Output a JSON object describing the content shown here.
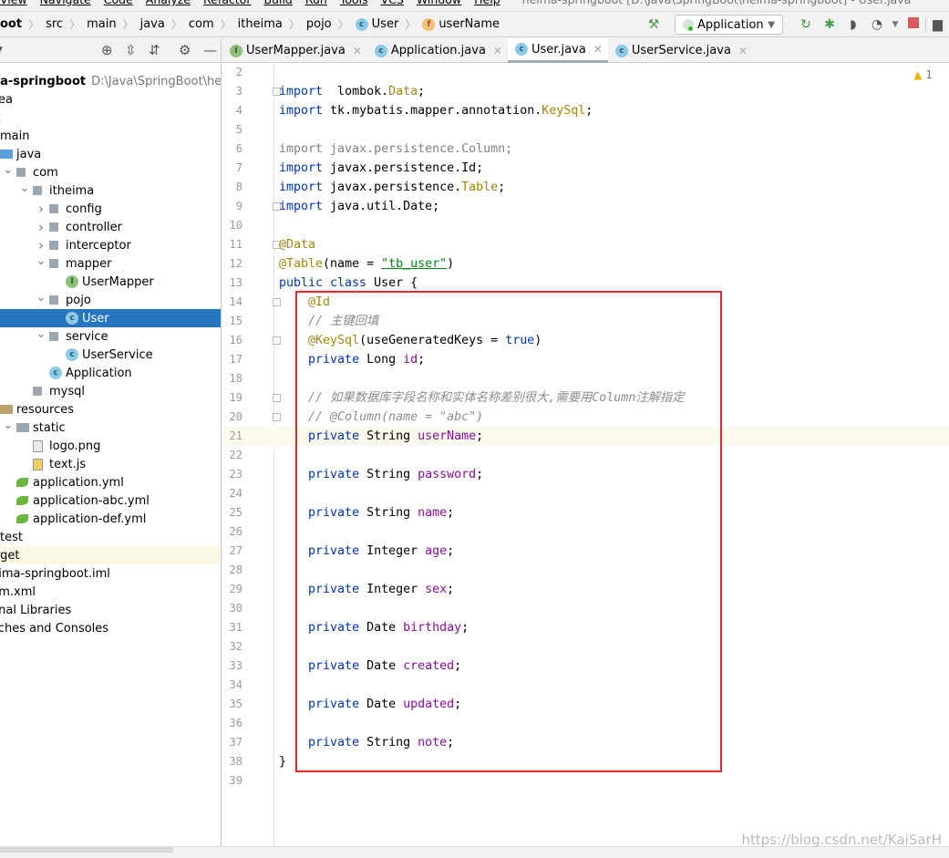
{
  "menu": {
    "items": [
      "View",
      "Navigate",
      "Code",
      "Analyze",
      "Refactor",
      "Build",
      "Run",
      "Tools",
      "VCS",
      "Window",
      "Help"
    ],
    "title": "heima-springboot [D:\\Java\\SpringBoot\\heima-springboot] - User.java"
  },
  "breadcrumb": [
    "oot",
    "src",
    "main",
    "java",
    "com",
    "itheima",
    "pojo",
    "User",
    "userName"
  ],
  "run_config": "Application",
  "project_tree": [
    {
      "label": "heima-springboot",
      "extra": "D:\\Java\\SpringBoot\\heima-springboot",
      "depth": 0,
      "icon": "module-folder",
      "bold": true
    },
    {
      "label": ".idea",
      "depth": 1,
      "icon": "folder"
    },
    {
      "label": "src",
      "depth": 1,
      "icon": "folder"
    },
    {
      "label": "main",
      "depth": 2,
      "icon": "folder",
      "expanded": true
    },
    {
      "label": "java",
      "depth": 3,
      "icon": "source-folder",
      "expanded": true
    },
    {
      "label": "com",
      "depth": 4,
      "icon": "package",
      "expanded": true,
      "arrow": true
    },
    {
      "label": "itheima",
      "depth": 5,
      "icon": "package",
      "expanded": true,
      "arrow": true
    },
    {
      "label": "config",
      "depth": 6,
      "icon": "package",
      "arrow": true
    },
    {
      "label": "controller",
      "depth": 6,
      "icon": "package",
      "arrow": true
    },
    {
      "label": "interceptor",
      "depth": 6,
      "icon": "package",
      "arrow": true
    },
    {
      "label": "mapper",
      "depth": 6,
      "icon": "package",
      "expanded": true,
      "arrow": true
    },
    {
      "label": "UserMapper",
      "depth": 7,
      "icon": "interface"
    },
    {
      "label": "pojo",
      "depth": 6,
      "icon": "package",
      "expanded": true,
      "arrow": true
    },
    {
      "label": "User",
      "depth": 7,
      "icon": "class",
      "selected": true
    },
    {
      "label": "service",
      "depth": 6,
      "icon": "package",
      "expanded": true,
      "arrow": true
    },
    {
      "label": "UserService",
      "depth": 7,
      "icon": "class"
    },
    {
      "label": "Application",
      "depth": 6,
      "icon": "spring-boot-class"
    },
    {
      "label": "mysql",
      "depth": 5,
      "icon": "package"
    },
    {
      "label": "resources",
      "depth": 3,
      "icon": "resources-folder",
      "arrow": true,
      "expanded": true
    },
    {
      "label": "static",
      "depth": 4,
      "icon": "folder",
      "expanded": true,
      "arrow": true
    },
    {
      "label": "logo.png",
      "depth": 5,
      "icon": "image-file"
    },
    {
      "label": "text.js",
      "depth": 5,
      "icon": "js-file"
    },
    {
      "label": "application.yml",
      "depth": 4,
      "icon": "yml-file"
    },
    {
      "label": "application-abc.yml",
      "depth": 4,
      "icon": "yml-file"
    },
    {
      "label": "application-def.yml",
      "depth": 4,
      "icon": "yml-file"
    },
    {
      "label": "test",
      "depth": 2,
      "icon": "folder"
    },
    {
      "label": "target",
      "depth": 1,
      "icon": "folder",
      "highlighted": true
    },
    {
      "label": "heima-springboot.iml",
      "depth": 1,
      "icon": "iml-file"
    },
    {
      "label": "pom.xml",
      "depth": 1,
      "icon": "xml-file"
    },
    {
      "label": "External Libraries",
      "depth": 0,
      "icon": "library"
    },
    {
      "label": "Scratches and Consoles",
      "depth": 0,
      "icon": "scratch"
    }
  ],
  "tabs": [
    {
      "label": "UserMapper.java",
      "icon": "I",
      "kind": "interface"
    },
    {
      "label": "Application.java",
      "icon": "C",
      "kind": "spring"
    },
    {
      "label": "User.java",
      "icon": "C",
      "kind": "class",
      "active": true
    },
    {
      "label": "UserService.java",
      "icon": "C",
      "kind": "class"
    }
  ],
  "editor": {
    "warnings": "1",
    "current_line": 21,
    "first_line": 2,
    "lines": [
      {
        "n": 2,
        "t": []
      },
      {
        "n": 3,
        "fold": true,
        "t": [
          [
            "kw",
            "import"
          ],
          [
            "",
            "  lombok."
          ],
          [
            "an",
            "Data"
          ],
          [
            "",
            ";"
          ]
        ]
      },
      {
        "n": 4,
        "t": [
          [
            "kw",
            "import"
          ],
          [
            "",
            " tk.mybatis.mapper.annotation."
          ],
          [
            "an",
            "KeySql"
          ],
          [
            "",
            ";"
          ]
        ]
      },
      {
        "n": 5,
        "t": []
      },
      {
        "n": 6,
        "t": [
          [
            "un",
            "import javax.persistence.Column;"
          ]
        ]
      },
      {
        "n": 7,
        "t": [
          [
            "kw",
            "import"
          ],
          [
            "",
            " javax.persistence.Id;"
          ]
        ]
      },
      {
        "n": 8,
        "t": [
          [
            "kw",
            "import"
          ],
          [
            "",
            " javax.persistence."
          ],
          [
            "an",
            "Table"
          ],
          [
            "",
            ";"
          ]
        ]
      },
      {
        "n": 9,
        "fold": true,
        "t": [
          [
            "kw",
            "import"
          ],
          [
            "",
            " java.util.Date;"
          ]
        ]
      },
      {
        "n": 10,
        "t": []
      },
      {
        "n": 11,
        "fold": true,
        "t": [
          [
            "an",
            "@Data"
          ]
        ]
      },
      {
        "n": 12,
        "t": [
          [
            "an",
            "@Table"
          ],
          [
            "",
            "(name = "
          ],
          [
            "st",
            "\"tb_user\""
          ],
          [
            "",
            ")"
          ]
        ]
      },
      {
        "n": 13,
        "t": [
          [
            "kw",
            "public class"
          ],
          [
            "",
            " User {"
          ]
        ]
      },
      {
        "n": 14,
        "fold": true,
        "t": [
          [
            "",
            "    "
          ],
          [
            "an",
            "@Id"
          ]
        ]
      },
      {
        "n": 15,
        "t": [
          [
            "",
            "    "
          ],
          [
            "cm",
            "// 主键回填"
          ]
        ]
      },
      {
        "n": 16,
        "fold": true,
        "t": [
          [
            "",
            "    "
          ],
          [
            "an",
            "@KeySql"
          ],
          [
            "",
            "(useGeneratedKeys = "
          ],
          [
            "kw",
            "true"
          ],
          [
            "",
            ")"
          ]
        ]
      },
      {
        "n": 17,
        "t": [
          [
            "",
            "    "
          ],
          [
            "kw",
            "private"
          ],
          [
            "",
            " Long "
          ],
          [
            "fd",
            "id"
          ],
          [
            "",
            ";"
          ]
        ]
      },
      {
        "n": 18,
        "t": []
      },
      {
        "n": 19,
        "fold": true,
        "t": [
          [
            "",
            "    "
          ],
          [
            "cm",
            "// 如果数据库字段名称和实体名称差别很大,需要用Column注解指定"
          ]
        ]
      },
      {
        "n": 20,
        "fold": true,
        "t": [
          [
            "",
            "    "
          ],
          [
            "cm",
            "// @Column(name = \"abc\")"
          ]
        ]
      },
      {
        "n": 21,
        "t": [
          [
            "",
            "    "
          ],
          [
            "kw",
            "private"
          ],
          [
            "",
            " String "
          ],
          [
            "fd",
            "userName"
          ],
          [
            "",
            ";"
          ]
        ]
      },
      {
        "n": 22,
        "t": []
      },
      {
        "n": 23,
        "t": [
          [
            "",
            "    "
          ],
          [
            "kw",
            "private"
          ],
          [
            "",
            " String "
          ],
          [
            "fd",
            "password"
          ],
          [
            "",
            ";"
          ]
        ]
      },
      {
        "n": 24,
        "t": []
      },
      {
        "n": 25,
        "t": [
          [
            "",
            "    "
          ],
          [
            "kw",
            "private"
          ],
          [
            "",
            " String "
          ],
          [
            "fd",
            "name"
          ],
          [
            "",
            ";"
          ]
        ]
      },
      {
        "n": 26,
        "t": []
      },
      {
        "n": 27,
        "t": [
          [
            "",
            "    "
          ],
          [
            "kw",
            "private"
          ],
          [
            "",
            " Integer "
          ],
          [
            "fd",
            "age"
          ],
          [
            "",
            ";"
          ]
        ]
      },
      {
        "n": 28,
        "t": []
      },
      {
        "n": 29,
        "t": [
          [
            "",
            "    "
          ],
          [
            "kw",
            "private"
          ],
          [
            "",
            " Integer "
          ],
          [
            "fd",
            "sex"
          ],
          [
            "",
            ";"
          ]
        ]
      },
      {
        "n": 30,
        "t": []
      },
      {
        "n": 31,
        "t": [
          [
            "",
            "    "
          ],
          [
            "kw",
            "private"
          ],
          [
            "",
            " Date "
          ],
          [
            "fd",
            "birthday"
          ],
          [
            "",
            ";"
          ]
        ]
      },
      {
        "n": 32,
        "t": []
      },
      {
        "n": 33,
        "t": [
          [
            "",
            "    "
          ],
          [
            "kw",
            "private"
          ],
          [
            "",
            " Date "
          ],
          [
            "fd",
            "created"
          ],
          [
            "",
            ";"
          ]
        ]
      },
      {
        "n": 34,
        "t": []
      },
      {
        "n": 35,
        "t": [
          [
            "",
            "    "
          ],
          [
            "kw",
            "private"
          ],
          [
            "",
            " Date "
          ],
          [
            "fd",
            "updated"
          ],
          [
            "",
            ";"
          ]
        ]
      },
      {
        "n": 36,
        "t": []
      },
      {
        "n": 37,
        "t": [
          [
            "",
            "    "
          ],
          [
            "kw",
            "private"
          ],
          [
            "",
            " String "
          ],
          [
            "fd",
            "note"
          ],
          [
            "",
            ";"
          ]
        ]
      },
      {
        "n": 38,
        "t": [
          [
            "",
            "}"
          ]
        ]
      },
      {
        "n": 39,
        "t": []
      }
    ]
  },
  "colors": {
    "highlight_box": "#e8262a",
    "selection": "#2675bf",
    "keyword": "#0033b3",
    "annotation": "#9e880d",
    "string": "#067d17",
    "field": "#871094",
    "comment": "#8c8c8c"
  },
  "watermark": "https://blog.csdn.net/KaiSarH"
}
